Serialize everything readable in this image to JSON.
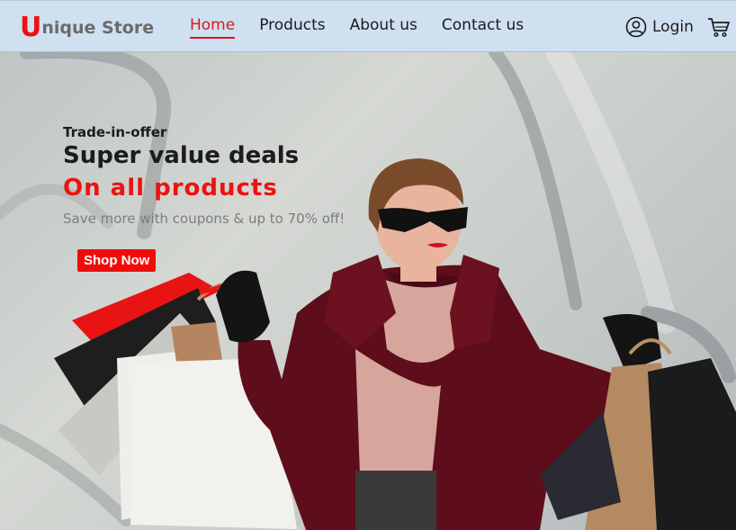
{
  "brand": {
    "first_letter": "U",
    "rest": "nique Store"
  },
  "nav": {
    "items": [
      {
        "label": "Home",
        "active": true
      },
      {
        "label": "Products",
        "active": false
      },
      {
        "label": "About us",
        "active": false
      },
      {
        "label": "Contact us",
        "active": false
      }
    ]
  },
  "header": {
    "login_label": "Login",
    "login_icon": "user-circle-icon",
    "cart_icon": "cart-icon"
  },
  "hero": {
    "eyebrow": "Trade-in-offer",
    "headline": "Super value deals",
    "highlight": "On all products",
    "subtext": "Save more with coupons & up to 70% off!",
    "cta_label": "Shop Now"
  },
  "colors": {
    "accent": "#ee1111",
    "header_bg": "#cfe0f1",
    "coat": "#5e0d1a"
  }
}
